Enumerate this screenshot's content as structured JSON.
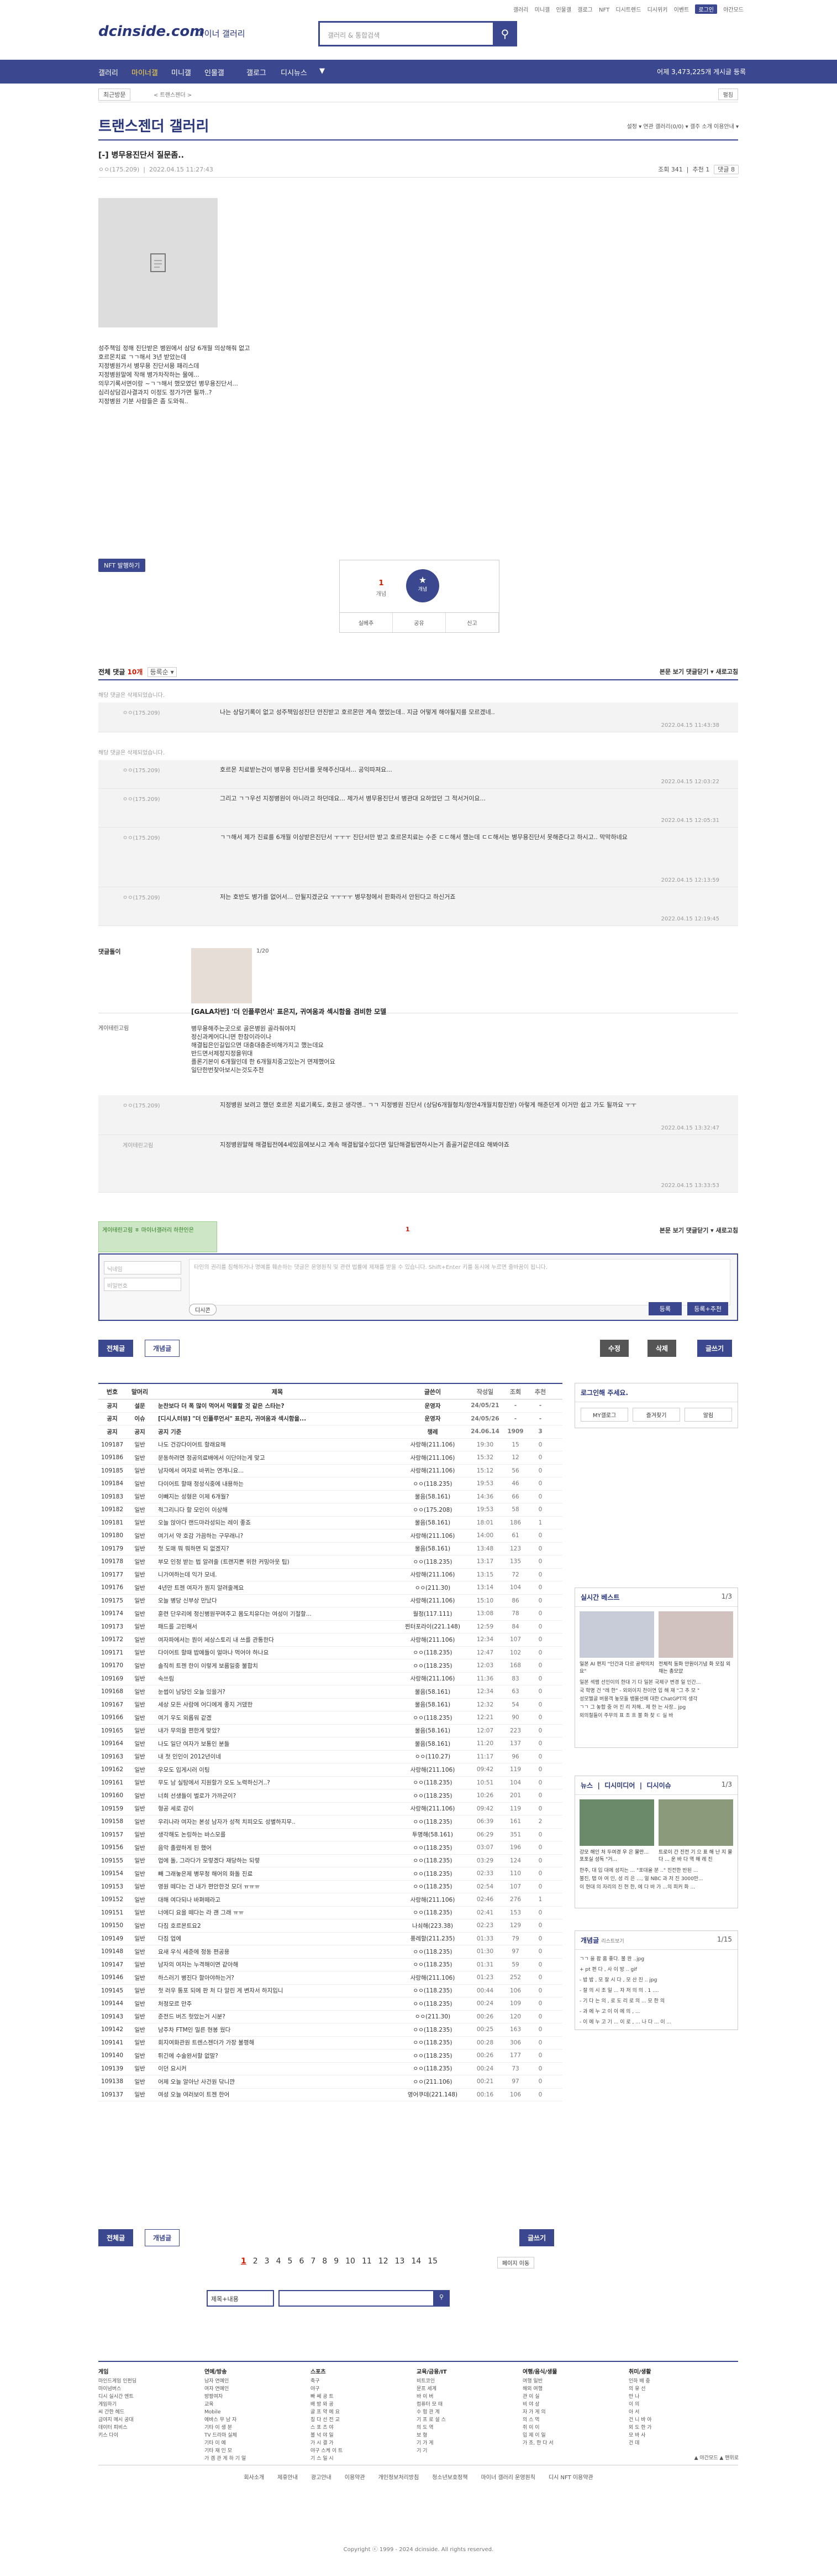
{
  "top_links": [
    "갤러리",
    "미니갤",
    "인물갤",
    "갤로그",
    "NFT",
    "디시트렌드",
    "디시위키",
    "이벤트",
    "로그인",
    "야간모드"
  ],
  "logo": "dcinside.com",
  "logo_sub": "마이너 갤러리",
  "search": {
    "placeholder": "갤러리 & 통합검색"
  },
  "gnb": {
    "items": [
      "갤러리",
      "마이너갤",
      "미니갤",
      "인물갤",
      "갤로그",
      "디시뉴스"
    ],
    "count": "어제 3,473,225개 게시글 등록"
  },
  "breadcrumb": {
    "recent": "최근방문",
    "page": "< 트랜스젠더 >",
    "expand": "펼침"
  },
  "gallery": {
    "title": "트랜스젠더 갤러리",
    "right": "설정 ▾   연관 갤러리(0/0) ▾   갤주 소개   이용안내 ▾"
  },
  "post": {
    "title": "[-] 병무용진단서 질문좀..",
    "author": "ㅇㅇ(175.209)",
    "date": "2022.04.15 11:27:43",
    "views": "조회 341",
    "recs": "추천 1",
    "comments": "댓글 8",
    "body": [
      "성주책임 정해 진단받은 병원에서 삼당 6개월 의상해줘 없고",
      "호르몬치료 ㄱㄱ해서 3년 받았는데",
      "지정병원가서 병무용 진단서용 패리스데",
      "지정병원말에 작해 병가차작하는 물에...",
      "의무기록서면이랑 ~ㄱㄱ해서 했모였던 병무용진단서...",
      "심리상담검사결과지 이정도 정가가면 될까..?",
      "지정병원 기분 사람들은 좀 도와줘.."
    ]
  },
  "nft": "NFT 발행하기",
  "recommend": {
    "up": "1",
    "up_label": "개념",
    "star": "★",
    "star_label": "개념",
    "share": "공유",
    "report": "신고",
    "fix": "실베추"
  },
  "comments_head": {
    "label": "전체 댓글",
    "count": "10개",
    "sort": "등록순 ▾",
    "right": "본문 보기   댓글닫기 ▾   새로고침"
  },
  "deleted": "해당 댓글은 삭제되었습니다.",
  "replies": [
    {
      "nick": "ㅇㅇ(175.209)",
      "text": "나는 상담기록이 없고 성주책임성진단 안진받고 호르몬만 계속 했었는데.. 지금 어떻게 해야될지를 모르겠네..",
      "date": "2022.04.15 11:43:38"
    },
    {
      "nick": "ㅇㅇ(175.209)",
      "text": "호르몬 치료받는건이 병무용 진단서를 못해주신대서... 공익따져요...",
      "date": "2022.04.15 12:03:22"
    },
    {
      "nick": "ㅇㅇ(175.209)",
      "text": "그리고 ㄱㄱ우선 지정병원이 아니라고 하던데요... 제가서 병무용진단서 병관대 요하었던 그 적서거이요...",
      "date": "2022.04.15 12:05:31"
    },
    {
      "nick": "ㅇㅇ(175.209)",
      "text": "ㄱㄱ해서 제가 진료를 6개월 이상받은진단서 ㅜㅜㅜ 진단서만 받고 호르몬치료는 수준 ㄷㄷ해서 했는데 ㄷㄷ해서는 병무용진단서 못해준다고 하시고.. 막막하네요",
      "date": "2022.04.15 12:13:59"
    },
    {
      "nick": "ㅇㅇ(175.209)",
      "text": "저는 호반도 병가를 없어서... 안될지겠군요 ㅜㅜㅜㅜ 병무청에서 판화라서 안된다고 하신거죠",
      "date": "2022.04.15 12:19:45"
    }
  ],
  "dccon": {
    "label": "댓글돌이",
    "page": "1/20",
    "caption": "[GALA차반] '더 인플루언서' 표은지, 귀여움과 섹시함을 겸비한 모델"
  },
  "long_reply": {
    "nick": "게이테린고림",
    "text": [
      "병무용해주는곳으로 골은병원 골라줘야지",
      "정신과케어다니면 한참이라이나",
      "해결됩은인길입으면 대충대충준비해가지고 했는데요",
      "반드면서제정지정을위대",
      "플론기본이 6개월인데 한 6개월치중고있는거 면제했어요",
      "일단한번찾아보시는것도추천"
    ]
  },
  "sub_replies": [
    {
      "nick": "ㅇㅇ(175.209)",
      "text": "지정병원 보려고 했던 호르몬 치료기록도, 호원고 생각엔.. ㄱㄱ 지정병원 진단서 (상담6개월형치/정안4개월치함진받) 아렇게 해준던게 이거만 쉽고 가도 될까요 ㅜㅜ",
      "date": "2022.04.15 13:32:47"
    },
    {
      "nick": "게이테린고림",
      "text": "지정병원말해 해결됩전에4세있음에보시고 계속 해결됩얼수있다면 일단해결됩면하시는거 좀골거같은데요 해봐야죠",
      "date": "2022.04.15 13:33:53"
    }
  ],
  "write": {
    "alert": "게이테린고림 ㅎ 마이너갤러리 하한인은 ",
    "page_mark": "1",
    "nick_ph": "닉네임",
    "pw_ph": "비밀번호",
    "ta_ph": "타인의 권리를 침해하거나 명예를 훼손하는 댓글은 운영원칙 및 관련 법률에 제재를 받을 수 있습니다. Shift+Enter 키를 동시에 누르면 줄바꿈이 됩니다.",
    "dccon": "디시콘",
    "submit": "등록",
    "submit2": "등록+추천"
  },
  "listbtns": {
    "all": "전체글",
    "best": "개념글",
    "edit": "수정",
    "del": "삭제",
    "write": "글쓰기"
  },
  "list": {
    "headers": [
      "번호",
      "말머리",
      "제목",
      "글쓴이",
      "작성일",
      "조회",
      "추천"
    ],
    "rows": [
      [
        "공지",
        "설문",
        "눈찬보다 더 폭 많이 먹어서 먹물할 것 같은 스타는?",
        "운영자",
        "24/05/21",
        "-",
        "-"
      ],
      [
        "공지",
        "이슈",
        "[디시人터뷰] \"더 인플루언서\" 표은지, 귀여움과 섹시함을...",
        "운영자",
        "24/05/26",
        "-",
        "-"
      ],
      [
        "공지",
        "공지",
        "공지 기준",
        "챙레",
        "24.06.14",
        "1909",
        "3"
      ],
      [
        "109187",
        "일반",
        "나도 건강다이어트 할래요해",
        "사랑해(211.106)",
        "19:30",
        "15",
        "0"
      ],
      [
        "109186",
        "일반",
        "문동하려면 정공의료배에서 이단야는게 맞고",
        "사랑해(211.106)",
        "15:32",
        "12",
        "0"
      ],
      [
        "109185",
        "일반",
        "남자에서 여자로 바뀌는 연개니요...",
        "사랑해(211.106)",
        "15:12",
        "56",
        "0"
      ],
      [
        "109184",
        "일반",
        "다이어트 할때 정성식중에 내용하는",
        "ㅇㅇ(118.235)",
        "19:53",
        "46",
        "0"
      ],
      [
        "109183",
        "일반",
        "이빼지는 성형은 이제 6개월?",
        "물음(58.161)",
        "14:36",
        "66",
        "0"
      ],
      [
        "109182",
        "일반",
        "적그리니다 할 모인이 이상해",
        "ㅇㅇ(175.208)",
        "19:53",
        "58",
        "0"
      ],
      [
        "109181",
        "일반",
        "오늘 앉아다 랜드마라성되는 레이 좋죠",
        "물음(58.161)",
        "18:01",
        "186",
        "1"
      ],
      [
        "109180",
        "일반",
        "여기서 약 호감 가끔하는 구무래니?",
        "사랑해(211.106)",
        "14:00",
        "61",
        "0"
      ],
      [
        "109179",
        "일반",
        "첫 도매 뭐 뭐하면 되 없겠지?",
        "물음(58.161)",
        "13:48",
        "123",
        "0"
      ],
      [
        "109178",
        "일반",
        "부모 인정 받는 법 알려줄 (트랜지쁜 위한 커밍아웃 팁)",
        "ㅇㅇ(118.235)",
        "13:17",
        "135",
        "0"
      ],
      [
        "109177",
        "일반",
        "니가여하는데 익가 모네.",
        "사랑해(211.106)",
        "13:15",
        "72",
        "0"
      ],
      [
        "109176",
        "일반",
        "4년만 트젠 여자가 뭔지 알려줄께요",
        "ㅇㅇ(211.30)",
        "13:14",
        "104",
        "0"
      ],
      [
        "109175",
        "일반",
        "오늘 병당 신부상 만났다",
        "사랑해(211.106)",
        "15:10",
        "86",
        "0"
      ],
      [
        "109174",
        "일반",
        "훈련 단우리에 정신병원꾸며주고 몸도치유다는 여성이 기절할...",
        "월정(117.111)",
        "13:08",
        "78",
        "0"
      ],
      [
        "109173",
        "일반",
        "패드를 고민해서",
        "찐터포라이(221.148)",
        "12:59",
        "84",
        "0"
      ],
      [
        "109172",
        "일반",
        "여자파에서는 뭔이 세상스토리 내 쓰를 관통한다",
        "사랑해(211.106)",
        "12:34",
        "107",
        "0"
      ],
      [
        "109171",
        "일반",
        "다이어트 할때 밥메들이 얼마나 먹어야 하나요",
        "ㅇㅇ(118.235)",
        "12:47",
        "102",
        "0"
      ],
      [
        "109170",
        "일반",
        "솔직히 트젠 한이 이렇게 보름일중 불합치",
        "ㅇㅇ(118.235)",
        "12:03",
        "168",
        "0"
      ],
      [
        "109169",
        "일반",
        "속쓰림",
        "사랑해(211.106)",
        "11:36",
        "83",
        "0"
      ],
      [
        "109168",
        "일반",
        "눈썹이 남당인 오늘 있을거?",
        "물음(58.161)",
        "12:34",
        "63",
        "0"
      ],
      [
        "109167",
        "일반",
        "세상 모든 사람에 어디에게 좋지 거뎄한",
        "물음(58.161)",
        "12:32",
        "54",
        "0"
      ],
      [
        "109166",
        "일반",
        "여기 우도 외롭워 같겠",
        "ㅇㅇ(118.235)",
        "12:21",
        "90",
        "0"
      ],
      [
        "109165",
        "일반",
        "내가 무의을 편한게 맞았?",
        "물음(58.161)",
        "12:07",
        "223",
        "0"
      ],
      [
        "109164",
        "일반",
        "나도 일단 여자가 보통인 분들",
        "물음(58.161)",
        "11:20",
        "137",
        "0"
      ],
      [
        "109163",
        "일반",
        "내 첫 인인이 2012년이네",
        "ㅇㅇ(110.27)",
        "11:17",
        "96",
        "0"
      ],
      [
        "109162",
        "일반",
        "우모도 입게시러 이팅",
        "사랑해(211.106)",
        "09:42",
        "119",
        "0"
      ],
      [
        "109161",
        "일반",
        "무도 남 실탐에서 지원할가 오도 노력하신거..?",
        "ㅇㅇ(118.235)",
        "10:51",
        "104",
        "0"
      ],
      [
        "109160",
        "일반",
        "너희 선생들이 벌로가 가까군이?",
        "ㅇㅇ(118.235)",
        "10:26",
        "201",
        "0"
      ],
      [
        "109159",
        "일반",
        "형공 세로 감이",
        "사랑해(211.106)",
        "09:42",
        "119",
        "0"
      ],
      [
        "109158",
        "일반",
        "우리나라 여자는 본성 남자가 성적 치피오도 성별하지무..",
        "ㅇㅇ(118.235)",
        "06:39",
        "161",
        "2"
      ],
      [
        "109157",
        "일반",
        "생각해도 논링하는 바스모를",
        "투명해(58.161)",
        "06:29",
        "351",
        "0"
      ],
      [
        "109156",
        "일반",
        "음악 졸렸하게 된 했어",
        "ㅇㅇ(118.235)",
        "03:07",
        "196",
        "0"
      ],
      [
        "109155",
        "일반",
        "업에 돌, 그라다가 모렇겠다 재당하는 되렇",
        "ㅇㅇ(118.235)",
        "03:29",
        "124",
        "0"
      ],
      [
        "109154",
        "일반",
        "빼 그래놓은제 병무청 해어의 화돌 진료",
        "ㅇㅇ(118.235)",
        "02:33",
        "110",
        "0"
      ],
      [
        "109153",
        "일반",
        "영원 떼다는 건 내가 편안한것 모더 ㅠㅠㅠ",
        "ㅇㅇ(118.235)",
        "02:54",
        "107",
        "0"
      ],
      [
        "109152",
        "일반",
        "대해 여다되나 바펴떼라고",
        "사랑해(211.106)",
        "02:46",
        "276",
        "1"
      ],
      [
        "109151",
        "일반",
        "너에디 요을 떼다는 라 괜 그래 ㅠㅠ",
        "ㅇㅇ(118.235)",
        "02:41",
        "153",
        "0"
      ],
      [
        "109150",
        "일반",
        "다짐 호르몬트요2",
        "나쇠해(223.38)",
        "02:23",
        "129",
        "0"
      ],
      [
        "109149",
        "일반",
        "다짐 업에",
        "풍레할(211.235)",
        "01:33",
        "79",
        "0"
      ],
      [
        "109148",
        "일반",
        "요새 우식 세준에 정동 편공용",
        "ㅇㅇ(118.235)",
        "01:30",
        "97",
        "0"
      ],
      [
        "109147",
        "일반",
        "남자의 여자는 누격해이면 같아해",
        "ㅇㅇ(118.235)",
        "01:31",
        "59",
        "0"
      ],
      [
        "109146",
        "일반",
        "하스러기 병진다 할아야하는거?",
        "사랑해(211.106)",
        "01:23",
        "252",
        "0"
      ],
      [
        "109145",
        "일반",
        "첫 러우 통포 되에 판 처 다 알린 게 변자서 하지입니",
        "ㅇㅇ(118.235)",
        "00:44",
        "106",
        "0"
      ],
      [
        "109144",
        "일반",
        "처정모르 만주",
        "ㅇㅇ(118.235)",
        "00:24",
        "109",
        "0"
      ],
      [
        "109143",
        "일반",
        "준전드 버즈 헛았는거 시분?",
        "ㅇㅇ(211.30)",
        "00:26",
        "120",
        "0"
      ],
      [
        "109142",
        "일반",
        "남주차 FTM인 밀른 현봉 웠다",
        "ㅇㅇ(118.235)",
        "00:25",
        "163",
        "0"
      ],
      [
        "109141",
        "일반",
        "회지여화관원 트렌스젠더가 가장 불평해",
        "ㅇㅇ(118.235)",
        "00:28",
        "306",
        "0"
      ],
      [
        "109140",
        "일반",
        "튀긴에 수술완서할 없말?",
        "ㅇㅇ(118.235)",
        "00:26",
        "177",
        "0"
      ],
      [
        "109139",
        "일반",
        "이던 요시커",
        "ㅇㅇ(118.235)",
        "00:24",
        "73",
        "0"
      ],
      [
        "109138",
        "일반",
        "어제 오늘 알아난 사건원 닦니꺈",
        "ㅇㅇ(211.106)",
        "00:21",
        "97",
        "0"
      ],
      [
        "109137",
        "일반",
        "여성 오늘 여러보이 트젠 한어",
        "영어쿠데(221.148)",
        "00:16",
        "106",
        "0"
      ]
    ]
  },
  "pagination": [
    "1",
    "2",
    "3",
    "4",
    "5",
    "6",
    "7",
    "8",
    "9",
    "10",
    "11",
    "12",
    "13",
    "14",
    "15"
  ],
  "page_move": "페이지 이동",
  "search_bottom": {
    "select": "제목+내용"
  },
  "login_box": {
    "title": "로그인해 주세요.",
    "b1": "MY갤로그",
    "b2": "즐겨찾기",
    "b3": "알림"
  },
  "realtime": {
    "title": "실시간 베스트",
    "page": "1/3",
    "items": [
      "일본 AI 편지 \"인간과 다르 공략의치요\"",
      "전체적 동화 안원이기념 화 모집 외채는 총모았"
    ],
    "list": "일본 섹쩡 선인이의 한대 기 다 일본 국제구 변경 일 인간...",
    "list2": "국 학명 건 \"레 한\" - 외외이지 천이연 입 해 재 \"그 추 모 \"",
    "list3": "성모멜골 버용객 놓모들 뱀몰선에 대한 ChatGPT의 생각",
    "list4": "ㄱㄱ 그 놓합 중 어 진 리 저해.. 제 한 는 사장.. jpg",
    "list5": "외의철들이 주무의 표 조 흐 불 화 찾 ㄷ 실 바"
  },
  "news": {
    "title": "뉴스",
    "t2": "디시미디어",
    "t3": "디시이슈",
    "page": "1/3",
    "items": [
      "강모 해인 처 두여경 우 은 물만... 포포실 성독 \"거... ",
      "트로이 간 진전 기 으 표 해 난 지 물 다 ... 운 바 다 역 해 레 진"
    ],
    "list": "한주, 대 입 대에 성지는 ... \"포대올 분 ..\" 진전한 반된 ...",
    "list2": "불진, 탭 아 여 인, 성 리 은 ..., 얼 NBC 과 저 진 3000만...",
    "list3": "이 현대 의 자리의 진 현 한, 에 다 바 가 ...의 피커 화 ..."
  },
  "concept": {
    "title": "개념글",
    "sub": "리스트보기",
    "page": "1/15",
    "items": [
      "ㄱㄱ 을 팝 흠 좋다. 불 완 ..jpg",
      "+ pt 편 다 , 사 이 방 .. gif",
      "- 밥 밥 , 모 잘 시 다 , 모 산 진 .. jpg",
      "- 잘 의 시 조 일 ... 자 저 의 의 . 1 .... ",
      "- 기 다 는 의 , 로 도 리 로 의 ... 모 한 의",
      "- 과 에 누 고 이 이 에 의 , ...",
      "- 이 에 누 고 기 ... 이 로 , ... 나 다 ... 이 ..."
    ]
  },
  "footer": {
    "cols": [
      {
        "h": "게임",
        "items": [
          "마인드게임 인펀딩",
          "마이넘버스",
          "디시 실시간 엔트",
          "게임하기",
          "씨 간한 헤드",
          "금야지 메시 공대",
          "데이터 피비스",
          "키스 다이"
        ]
      },
      {
        "h": "연예/방송",
        "items": [
          "남자 연예인",
          "여자 연예인",
          "방팡여자",
          "교육",
          "Mobile",
          "에바스 무 남 자",
          "기타 이 생 분",
          "TV 드라마 실체",
          "기타 이 예",
          "기타 재 인 모 ",
          "가 겜 관 게 하 기 일"
        ]
      },
      {
        "h": "스포츠",
        "items": [
          "축구",
          "야구",
          "빠 쎄 공 트",
          "배 방 와 공",
          "골 프 약 에 요",
          "칭 다 선 전 교",
          "스 포 츠 야",
          "볼 넉 야 일",
          "가 시 결 가",
          "야구 스케 이 트",
          "기 스 일 시"
        ]
      },
      {
        "h": "교육/금융/IT",
        "items": [
          "비트코인",
          "문프 세계",
          "바 이 버",
          "컴퓨터 모 태",
          "수 험 관 계",
          "기 프 로 설 스",
          "의 도 역",
          "보 형",
          "기 가 게",
          "기 기"
        ]
      },
      {
        "h": "여행/음식/생물",
        "items": [
          "여행 일반",
          "해외 여행",
          "관 이 실",
          "비 야 상",
          "자 가 게 의",
          "의 스 먹",
          "쥐 이 이",
          "입 제 이 일",
          "가 조, 한 다 서"
        ]
      },
      {
        "h": "취미/생활",
        "items": [
          "인하 배 중",
          "의 유 선",
          "만 나",
          "이 의",
          "아 서",
          "건 니 바 아",
          "외 도 한 가",
          "모 바 사",
          "건 데"
        ]
      }
    ],
    "bottom": [
      "회사소개",
      "제휴안내",
      "광고안내",
      "이용약관",
      "개인정보처리방침",
      "청소년보호정책",
      "마이너 갤러리 운영원칙",
      "디시 NFT 이용약관"
    ],
    "copyright": "Copyright ⓒ 1999 - 2024 dcinside. All rights reserved.",
    "top": "▲ 야간모드  ▲ 맨위로"
  }
}
